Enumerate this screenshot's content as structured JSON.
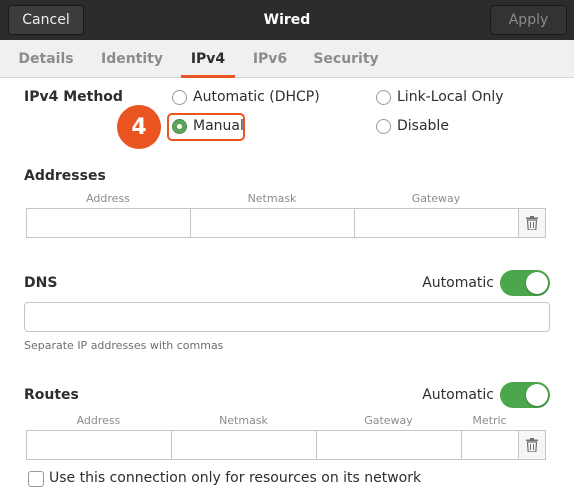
{
  "header": {
    "title": "Wired",
    "cancel_label": "Cancel",
    "apply_label": "Apply"
  },
  "tabs": [
    {
      "label": "Details"
    },
    {
      "label": "Identity"
    },
    {
      "label": "IPv4",
      "active": true
    },
    {
      "label": "IPv6"
    },
    {
      "label": "Security"
    }
  ],
  "ipv4_method": {
    "label": "IPv4 Method",
    "options": [
      {
        "label": "Automatic (DHCP)",
        "checked": false
      },
      {
        "label": "Link-Local Only",
        "checked": false
      },
      {
        "label": "Manual",
        "checked": true
      },
      {
        "label": "Disable",
        "checked": false
      }
    ],
    "step_badge": "4",
    "highlight_color": "#e95420"
  },
  "addresses": {
    "label": "Addresses",
    "columns": [
      "Address",
      "Netmask",
      "Gateway"
    ],
    "row": {
      "address": "",
      "netmask": "",
      "gateway": ""
    }
  },
  "dns": {
    "label": "DNS",
    "automatic_label": "Automatic",
    "automatic_on": true,
    "value": "",
    "hint": "Separate IP addresses with commas"
  },
  "routes": {
    "label": "Routes",
    "automatic_label": "Automatic",
    "automatic_on": true,
    "columns": [
      "Address",
      "Netmask",
      "Gateway",
      "Metric"
    ],
    "row": {
      "address": "",
      "netmask": "",
      "gateway": "",
      "metric": ""
    }
  },
  "only_local": {
    "label": "Use this connection only for resources on its network",
    "checked": false
  },
  "colors": {
    "accent": "#e95420",
    "switch_on": "#4ca64c",
    "header_bg": "#2c2c2c"
  },
  "icons": {
    "delete": "trash-icon"
  }
}
